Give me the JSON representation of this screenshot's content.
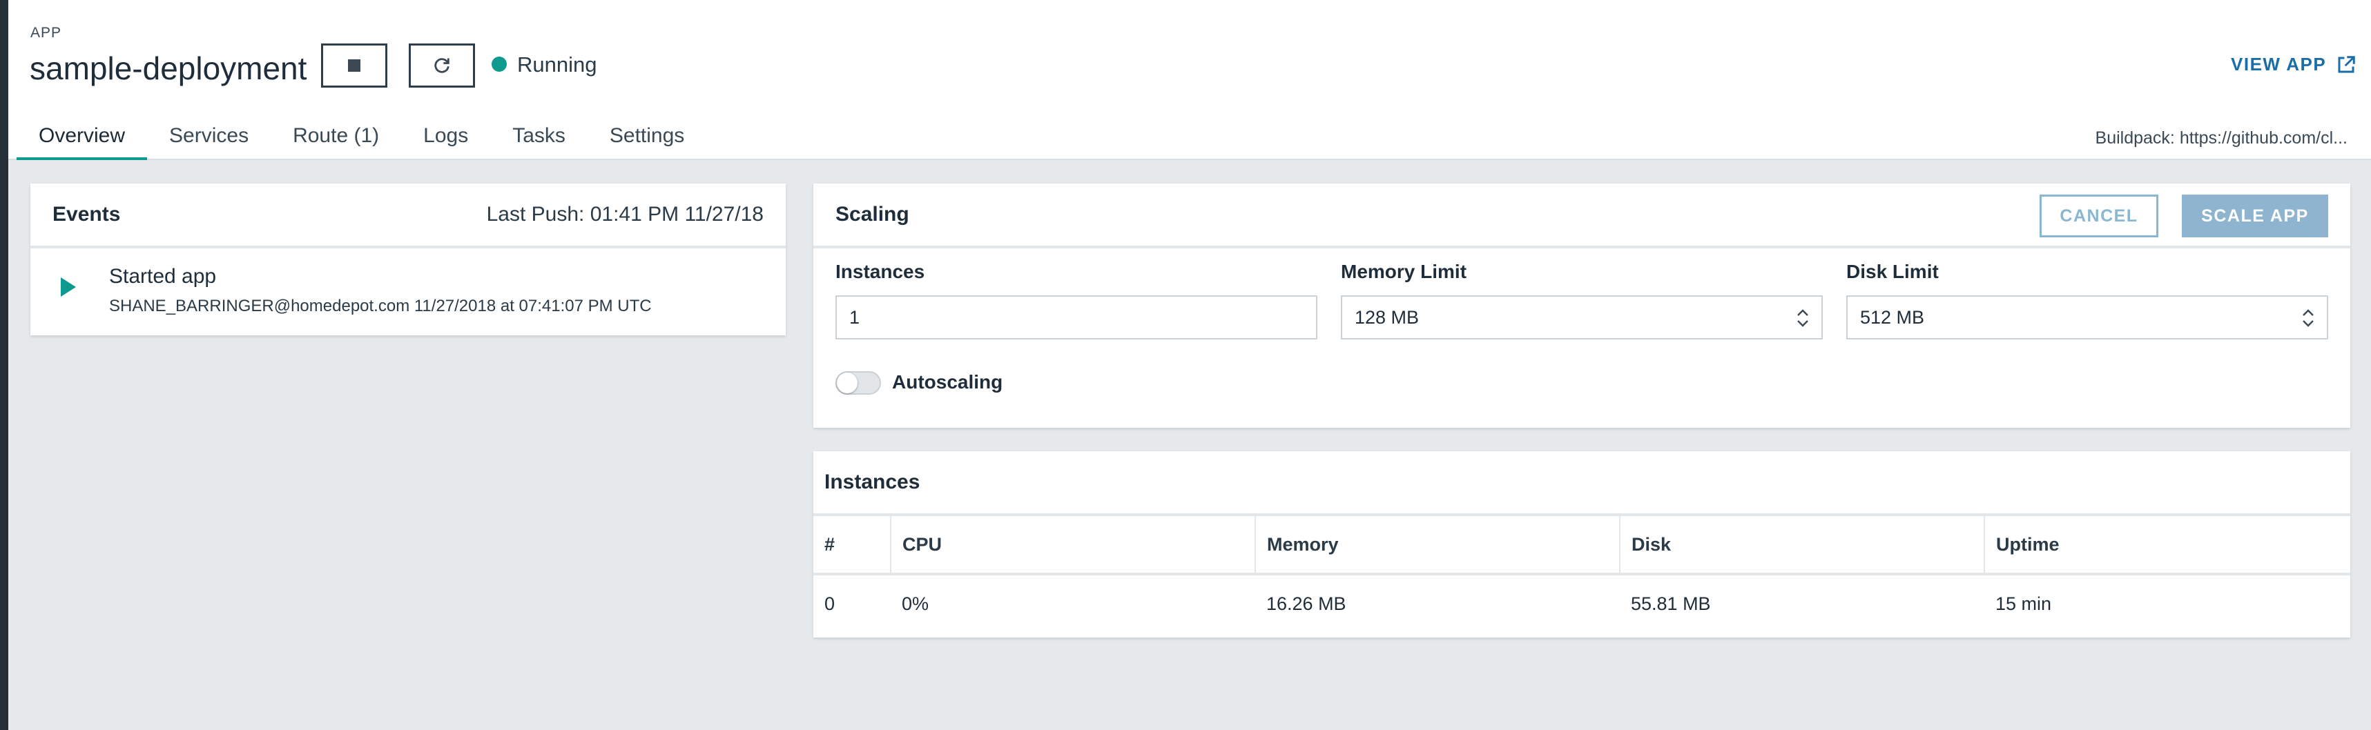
{
  "header": {
    "eyebrow": "APP",
    "title": "sample-deployment",
    "status": "Running",
    "status_color": "#10998e",
    "view_app": "VIEW APP",
    "buildpack": "Buildpack: https://github.com/cl..."
  },
  "icons": {
    "stop": "stop-icon",
    "restart": "refresh-icon",
    "external": "external-link-icon",
    "play": "play-icon",
    "chevron": "up-down-chevron-icon"
  },
  "tabs": [
    {
      "label": "Overview",
      "active": true
    },
    {
      "label": "Services"
    },
    {
      "label": "Route (1)"
    },
    {
      "label": "Logs"
    },
    {
      "label": "Tasks"
    },
    {
      "label": "Settings"
    }
  ],
  "events": {
    "title": "Events",
    "last_push": "Last Push: 01:41 PM 11/27/18",
    "items": [
      {
        "title": "Started app",
        "meta": "SHANE_BARRINGER@homedepot.com 11/27/2018 at 07:41:07 PM UTC"
      }
    ]
  },
  "scaling": {
    "title": "Scaling",
    "cancel_label": "CANCEL",
    "scale_label": "SCALE APP",
    "instances_label": "Instances",
    "instances_value": "1",
    "memory_label": "Memory Limit",
    "memory_value": "128 MB",
    "disk_label": "Disk Limit",
    "disk_value": "512 MB",
    "autoscaling_label": "Autoscaling",
    "autoscaling_on": false
  },
  "instances": {
    "title": "Instances",
    "columns": [
      "#",
      "CPU",
      "Memory",
      "Disk",
      "Uptime"
    ],
    "rows": [
      [
        "0",
        "0%",
        "16.26 MB",
        "55.81 MB",
        "15 min"
      ]
    ]
  }
}
